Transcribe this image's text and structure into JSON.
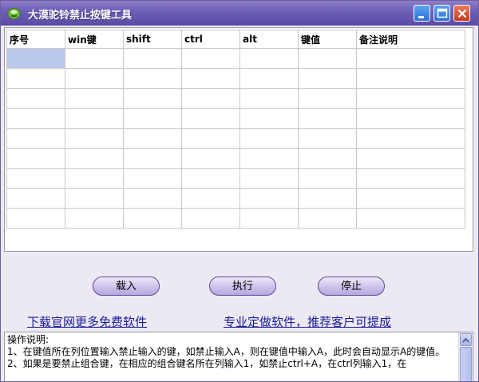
{
  "window": {
    "title": "大漠驼铃禁止按键工具"
  },
  "titlebar_buttons": {
    "minimize_icon": "minimize-icon",
    "maximize_icon": "maximize-icon",
    "close_icon": "close-icon"
  },
  "grid": {
    "columns": [
      "序号",
      "win键",
      "shift",
      "ctrl",
      "alt",
      "键值",
      "备注说明"
    ],
    "row_count": 9,
    "selected_cell": "row 1, column 1"
  },
  "buttons": {
    "load": "载入",
    "execute": "执行",
    "stop": "停止"
  },
  "links": {
    "download": "下载官网更多免费软件",
    "custom": "专业定做软件，推荐客户可提成"
  },
  "instructions": {
    "heading": "操作说明:",
    "line1": "1、在键值所在列位置输入禁止输入的键，如禁止输入A，则在键值中输入A，此时会自动显示A的键值。",
    "line2": "2、如果是要禁止组合键，在相应的组合键名所在列输入1，如禁止ctrl+A，在ctrl列输入1，在"
  },
  "colors": {
    "titlebar": "#6e5eb7",
    "selected_cell": "#b8c9ec",
    "button": "#cfc4ec",
    "link": "#1a1a9a"
  }
}
